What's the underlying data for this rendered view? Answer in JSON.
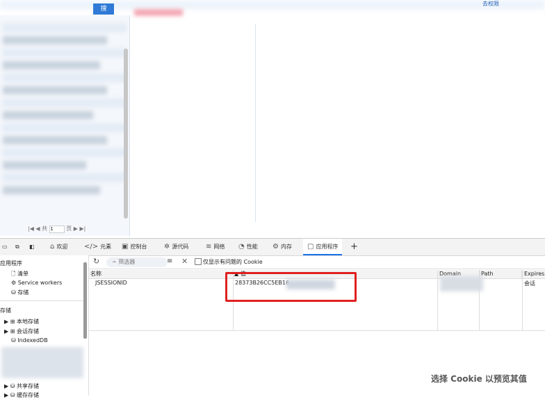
{
  "page": {
    "search_button": "搜",
    "right_link": "去权限",
    "pager": {
      "prefix": "共",
      "page_input": "1",
      "page_suffix": "页"
    }
  },
  "devtools": {
    "tabs": [
      {
        "icon": "home-icon",
        "label": "欢迎"
      },
      {
        "icon": "code-icon",
        "label": "元素"
      },
      {
        "icon": "console-icon",
        "label": "控制台"
      },
      {
        "icon": "bug-icon",
        "label": "源代码"
      },
      {
        "icon": "wifi-icon",
        "label": "网络"
      },
      {
        "icon": "performance-icon",
        "label": "性能"
      },
      {
        "icon": "memory-icon",
        "label": "内存"
      },
      {
        "icon": "application-icon",
        "label": "应用程序"
      }
    ],
    "active_tab": "应用程序",
    "sidebar": {
      "app_header": "应用程序",
      "app_items": [
        "清单",
        "Service workers",
        "存储"
      ],
      "storage_header": "存储",
      "storage_items": [
        "本地存储",
        "会话存储",
        "IndexedDB"
      ],
      "bottom_items": [
        "共享存储",
        "缓存存储"
      ]
    },
    "filter": {
      "placeholder": "筛选器",
      "only_issues_label": "仅显示有问题的 Cookie"
    },
    "table": {
      "columns": [
        "名称",
        "值",
        "Domain",
        "Path",
        "Expires / ..."
      ],
      "rows": [
        {
          "name": "JSESSIONID",
          "value": "28373B26CC5EB16",
          "domain": "",
          "path": "",
          "expires": "会话"
        }
      ]
    },
    "preview_hint": "选择 Cookie 以预览其值"
  },
  "colors": {
    "accent": "#1a73e8",
    "highlight": "#e02020"
  }
}
